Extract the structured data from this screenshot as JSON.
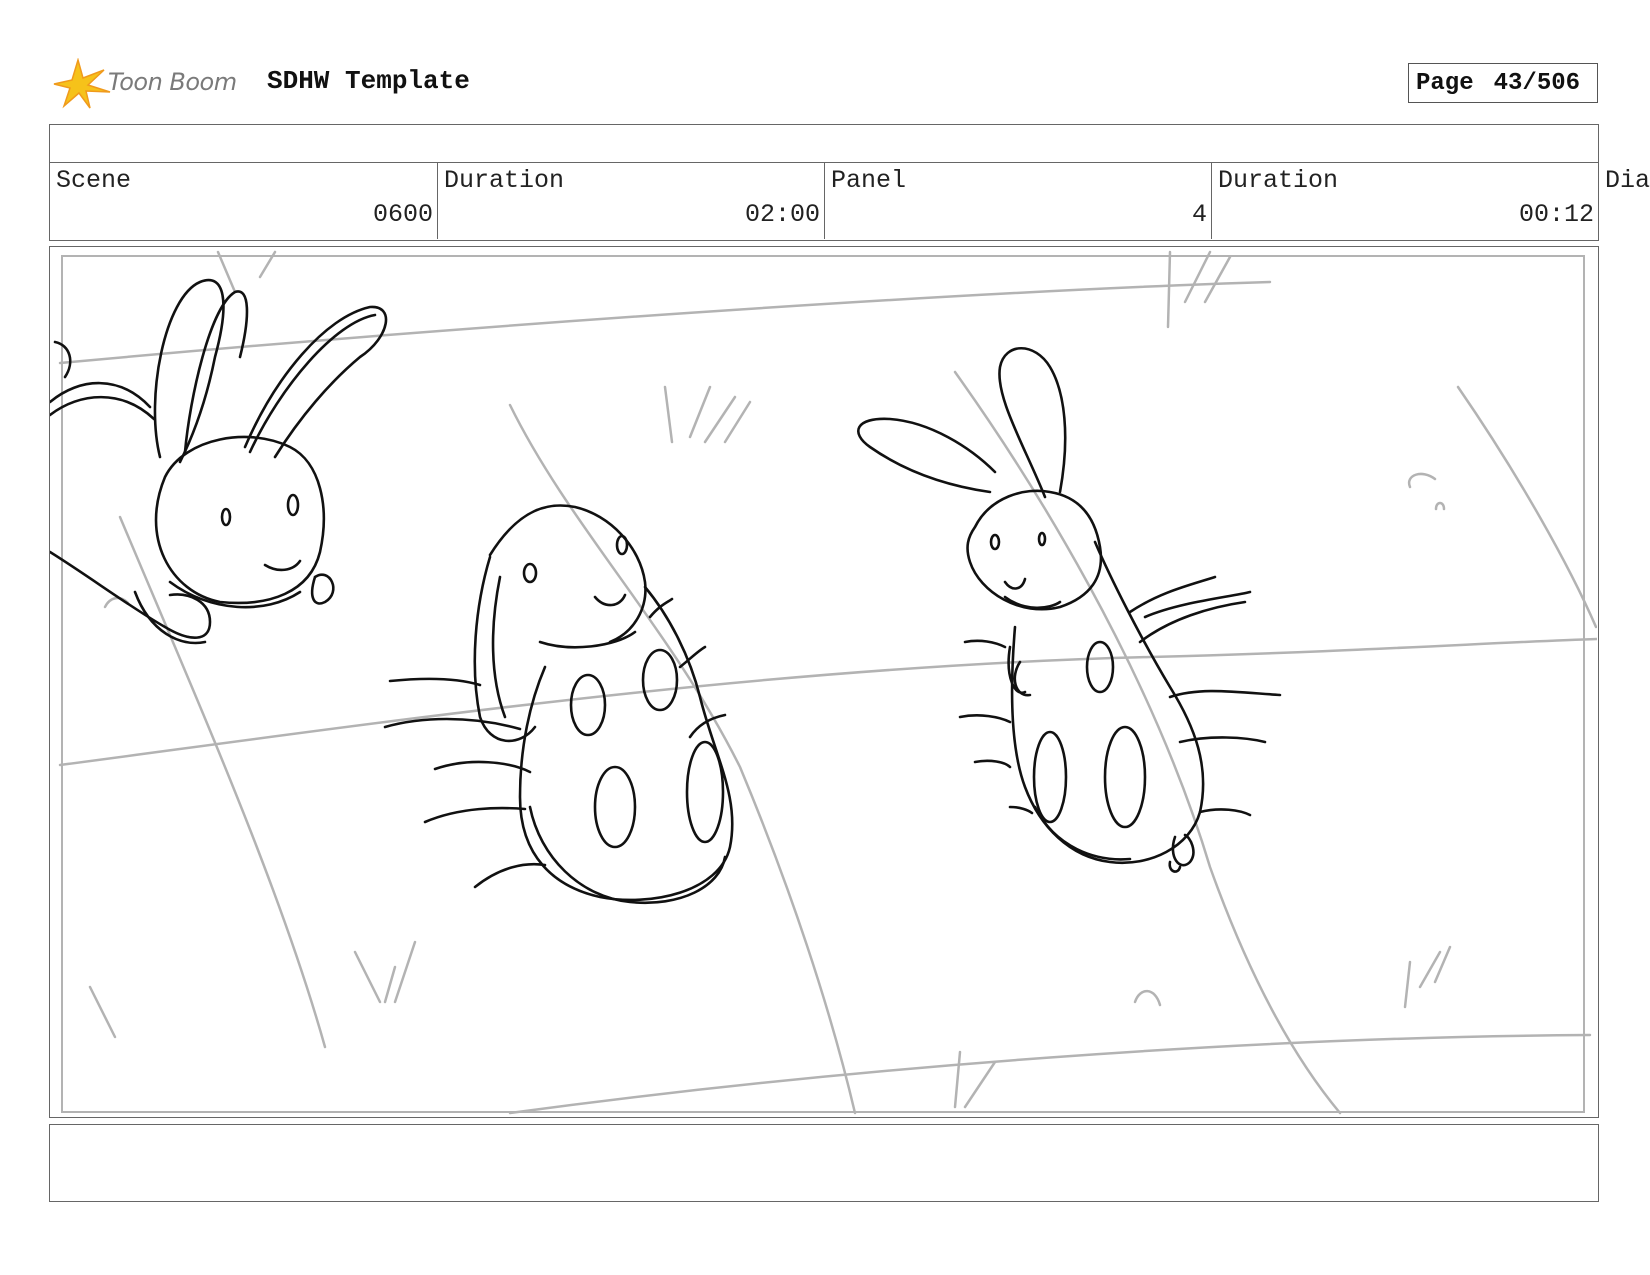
{
  "header": {
    "brand": "Toon Boom",
    "brand_icon": "toon-boom-star-icon",
    "template_title": "SDHW Template",
    "page_label": "Page",
    "page_number": "43/506"
  },
  "info": {
    "scene_label": "Scene",
    "scene_value": "0600",
    "scene_duration_label": "Duration",
    "scene_duration_value": "02:00",
    "panel_label": "Panel",
    "panel_value": "4",
    "panel_duration_label": "Duration",
    "panel_duration_value": "00:12",
    "dialog_label_truncated": "Dia"
  },
  "panel": {
    "illustration": "rabbit-sketch",
    "ink_color": "#111111",
    "guide_color": "#b3b3b3"
  },
  "colors": {
    "logo_yellow": "#f6c21a",
    "logo_orange": "#f09a1c",
    "border": "#666666"
  }
}
